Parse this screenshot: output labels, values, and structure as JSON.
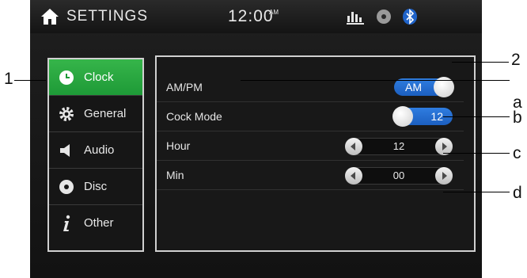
{
  "header": {
    "title": "SETTINGS",
    "time": "12:00",
    "ampm": "AM"
  },
  "menu": {
    "items": [
      {
        "label": "Clock"
      },
      {
        "label": "General"
      },
      {
        "label": "Audio"
      },
      {
        "label": "Disc"
      },
      {
        "label": "Other"
      }
    ]
  },
  "settings": {
    "ampm": {
      "label": "AM/PM",
      "value": "AM"
    },
    "clock_mode": {
      "label": "Cock Mode",
      "value": "12"
    },
    "hour": {
      "label": "Hour",
      "value": "12"
    },
    "min": {
      "label": "Min",
      "value": "00"
    }
  },
  "callouts": {
    "one": "1",
    "two": "2",
    "a": "a",
    "b": "b",
    "c": "c",
    "d": "d"
  },
  "colors": {
    "accent_green": "#1e9a37",
    "toggle_blue": "#1c5fc0"
  },
  "icons": {
    "home": "home-icon",
    "equalizer": "equalizer-icon",
    "disc": "disc-icon",
    "bluetooth": "bluetooth-icon"
  }
}
